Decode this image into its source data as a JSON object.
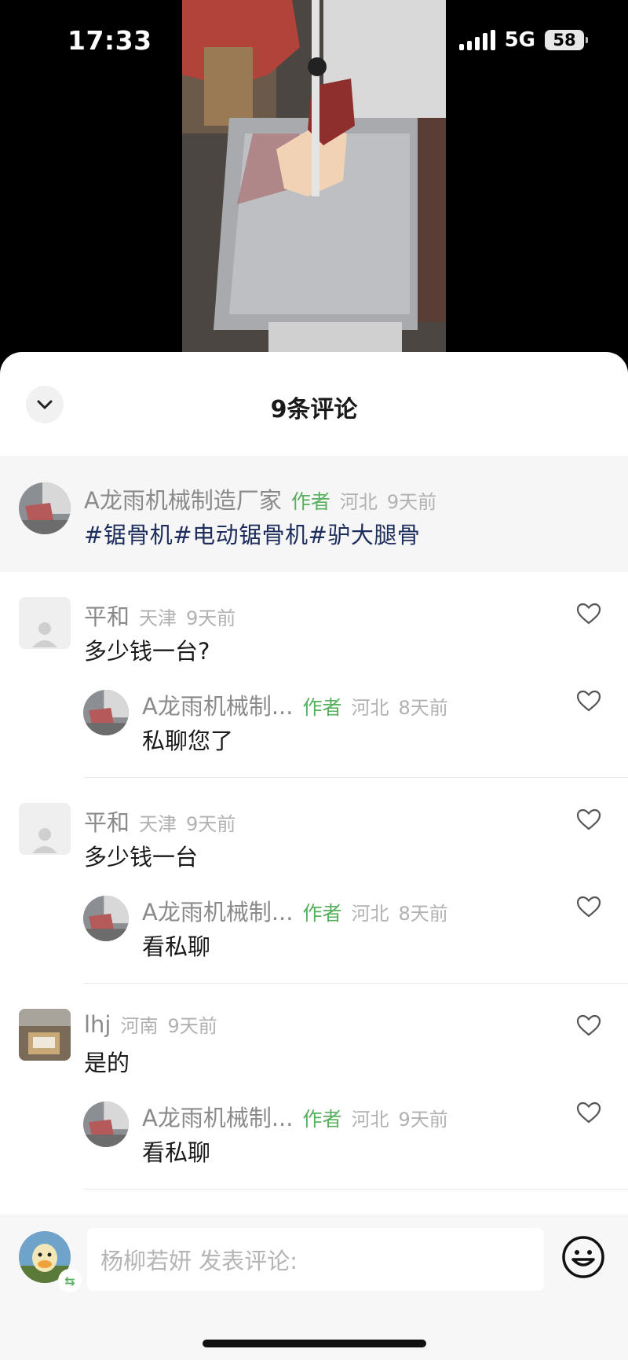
{
  "status_bar": {
    "time": "17:33",
    "network": "5G",
    "battery": "58"
  },
  "sheet": {
    "title": "9条评论"
  },
  "pinned_post": {
    "user": "A龙雨机械制造厂家",
    "author_tag": "作者",
    "location": "河北",
    "time": "9天前",
    "text": "#锯骨机#电动锯骨机#驴大腿骨"
  },
  "comments": [
    {
      "user": "平和",
      "location": "天津",
      "time": "9天前",
      "text": "多少钱一台?",
      "reply": {
        "user": "A龙雨机械制...",
        "author_tag": "作者",
        "location": "河北",
        "time": "8天前",
        "text": "私聊您了"
      }
    },
    {
      "user": "平和",
      "location": "天津",
      "time": "9天前",
      "text": "多少钱一台",
      "reply": {
        "user": "A龙雨机械制...",
        "author_tag": "作者",
        "location": "河北",
        "time": "8天前",
        "text": "看私聊"
      }
    },
    {
      "user": "lhj",
      "location": "河南",
      "time": "9天前",
      "text": "是的",
      "reply": {
        "user": "A龙雨机械制...",
        "author_tag": "作者",
        "location": "河北",
        "time": "9天前",
        "text": "看私聊"
      }
    }
  ],
  "input": {
    "placeholder": "杨柳若妍 发表评论:"
  },
  "colors": {
    "author_green": "#57b05e",
    "hashtag_navy": "#1d2d5c",
    "meta_gray": "#b1b1b1"
  },
  "icons": [
    "chevron-down-icon",
    "heart-icon",
    "emoji-icon",
    "switch-account-icon"
  ]
}
